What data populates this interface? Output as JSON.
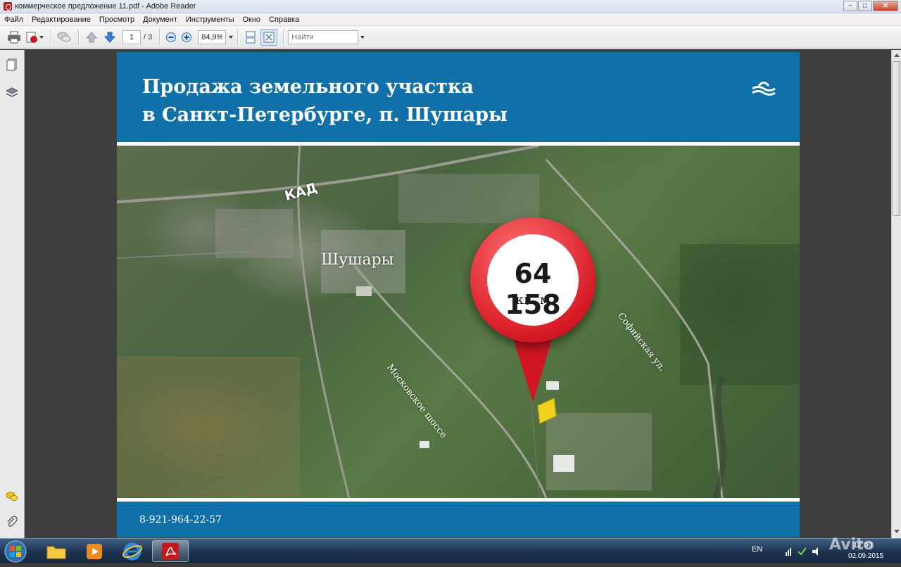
{
  "window": {
    "title": "коммерческое предложение 11.pdf - Adobe Reader",
    "minimize": "−",
    "maximize": "□",
    "close": "✕"
  },
  "menu": [
    "Файл",
    "Редактирование",
    "Просмотр",
    "Документ",
    "Инструменты",
    "Окно",
    "Справка"
  ],
  "toolbar": {
    "page_current": "1",
    "page_total": "/ 3",
    "zoom": "84,9%",
    "find_placeholder": "Найти"
  },
  "page": {
    "header_line1": "Продажа земельного участка",
    "header_line2": "в Санкт-Петербурге, п. Шушары",
    "area_value": "64 158",
    "area_unit": "кв. м",
    "label_kad": "КАД",
    "label_shushary": "Шушары",
    "label_sofia": "Софийская ул.",
    "label_moscow": "Московское шоссе",
    "phone": "8-921-964-22-57"
  },
  "taskbar": {
    "lang": "EN",
    "time": "12:00",
    "date": "02.09.2015",
    "watermark": "Avito"
  },
  "colors": {
    "header_blue": "#1070aa",
    "pin_red": "#d71a26",
    "plot_yellow": "#f0d21e"
  }
}
